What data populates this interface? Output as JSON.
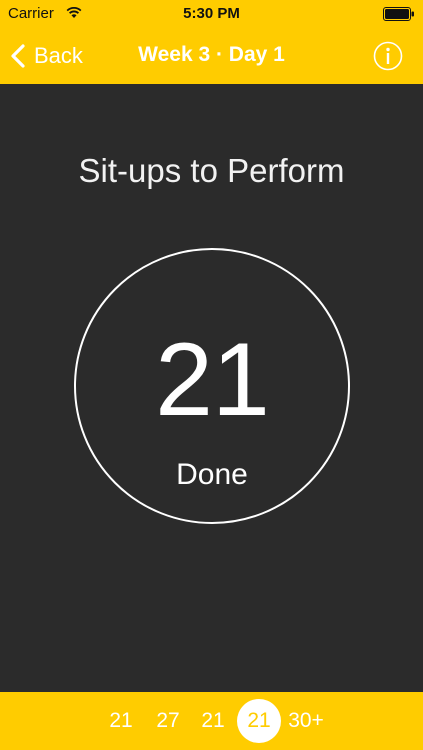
{
  "status_bar": {
    "carrier": "Carrier",
    "time": "5:30 PM",
    "wifi_icon": "wifi-icon",
    "battery_icon": "battery-icon"
  },
  "nav": {
    "back_label": "Back",
    "back_icon": "chevron-left-icon",
    "title": "Week 3 · Day 1",
    "info_icon": "info-icon"
  },
  "main": {
    "title": "Sit-ups to Perform",
    "counter_value": "21",
    "counter_action": "Done"
  },
  "sets": {
    "items": [
      "21",
      "27",
      "21",
      "21",
      "30+"
    ],
    "active_index": 3
  },
  "colors": {
    "accent": "#ffcc00",
    "background": "#2b2b2b",
    "text": "#ffffff"
  }
}
